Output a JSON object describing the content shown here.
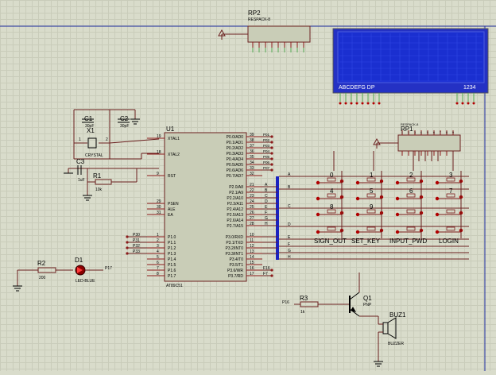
{
  "chips": {
    "u1": {
      "ref": "U1",
      "part": "AT89C51"
    },
    "rp2": {
      "ref": "RP2",
      "part": "RESPACK-8"
    },
    "rp1": {
      "ref": "RP1",
      "part": "RESPACK-8"
    },
    "x1": {
      "ref": "X1",
      "part": "CRYSTAL"
    },
    "c1": {
      "ref": "C1",
      "value": "30pF"
    },
    "c2": {
      "ref": "C2",
      "value": "30pF"
    },
    "c3": {
      "ref": "C3",
      "value": "1uF"
    },
    "r1": {
      "ref": "R1",
      "value": "10k"
    },
    "r2": {
      "ref": "R2",
      "value": "200"
    },
    "r3": {
      "ref": "R3",
      "value": "1k"
    },
    "d1": {
      "ref": "D1",
      "part": "LED-BLUE"
    },
    "q1": {
      "ref": "Q1",
      "part": "PNP"
    },
    "buz1": {
      "ref": "BUZ1",
      "part": "BUZZER"
    }
  },
  "u1_left_pins": [
    {
      "num": "19",
      "name": "XTAL1"
    },
    {
      "num": "18",
      "name": "XTAL2"
    },
    {
      "num": "9",
      "name": "RST"
    },
    {
      "num": "29",
      "name": "PSEN"
    },
    {
      "num": "30",
      "name": "ALE"
    },
    {
      "num": "31",
      "name": "EA"
    },
    {
      "num": "1",
      "name": "P1.0"
    },
    {
      "num": "2",
      "name": "P1.1"
    },
    {
      "num": "3",
      "name": "P1.2"
    },
    {
      "num": "4",
      "name": "P1.3"
    },
    {
      "num": "5",
      "name": "P1.4"
    },
    {
      "num": "6",
      "name": "P1.5"
    },
    {
      "num": "7",
      "name": "P1.6"
    },
    {
      "num": "8",
      "name": "P1.7"
    }
  ],
  "u1_right_pins": [
    {
      "num": "39",
      "name": "P0.0/AD0"
    },
    {
      "num": "38",
      "name": "P0.1/AD1"
    },
    {
      "num": "37",
      "name": "P0.2/AD2"
    },
    {
      "num": "36",
      "name": "P0.3/AD3"
    },
    {
      "num": "35",
      "name": "P0.4/AD4"
    },
    {
      "num": "34",
      "name": "P0.5/AD5"
    },
    {
      "num": "33",
      "name": "P0.6/AD6"
    },
    {
      "num": "32",
      "name": "P0.7/AD7"
    },
    {
      "num": "21",
      "name": "P2.0/A8"
    },
    {
      "num": "22",
      "name": "P2.1/A9"
    },
    {
      "num": "23",
      "name": "P2.2/A10"
    },
    {
      "num": "24",
      "name": "P2.3/A11"
    },
    {
      "num": "25",
      "name": "P2.4/A12"
    },
    {
      "num": "26",
      "name": "P2.5/A13"
    },
    {
      "num": "27",
      "name": "P2.6/A14"
    },
    {
      "num": "28",
      "name": "P2.7/A15"
    },
    {
      "num": "10",
      "name": "P3.0/RXD"
    },
    {
      "num": "11",
      "name": "P3.1/TXD"
    },
    {
      "num": "12",
      "name": "P3.2/INT0"
    },
    {
      "num": "13",
      "name": "P3.3/INT1"
    },
    {
      "num": "14",
      "name": "P3.4/T0"
    },
    {
      "num": "15",
      "name": "P3.5/T1"
    },
    {
      "num": "16",
      "name": "P3.6/WR"
    },
    {
      "num": "17",
      "name": "P3.7/RD"
    }
  ],
  "net_labels": {
    "p0": [
      "P01",
      "P02",
      "P03",
      "P04",
      "P05",
      "P06",
      "P07"
    ],
    "p1": [
      "P30",
      "P31",
      "P32",
      "P33"
    ],
    "p3": [
      "F16",
      "F7"
    ],
    "led": "P17",
    "q1_base": "P16",
    "bus": [
      "A",
      "B",
      "C",
      "D",
      "E",
      "F",
      "G",
      "H"
    ]
  },
  "keypad": {
    "digits": [
      "0",
      "1",
      "2",
      "3",
      "4",
      "5",
      "6",
      "7",
      "8",
      "9"
    ],
    "function_keys": [
      "SIGN_OUT",
      "SET_KEY",
      "INPUT_PWD",
      "LOGIN"
    ]
  },
  "lcd": {
    "bottom_left": "ABCDEFG DP",
    "bottom_right": "1234",
    "color": "#1a2fd0"
  }
}
